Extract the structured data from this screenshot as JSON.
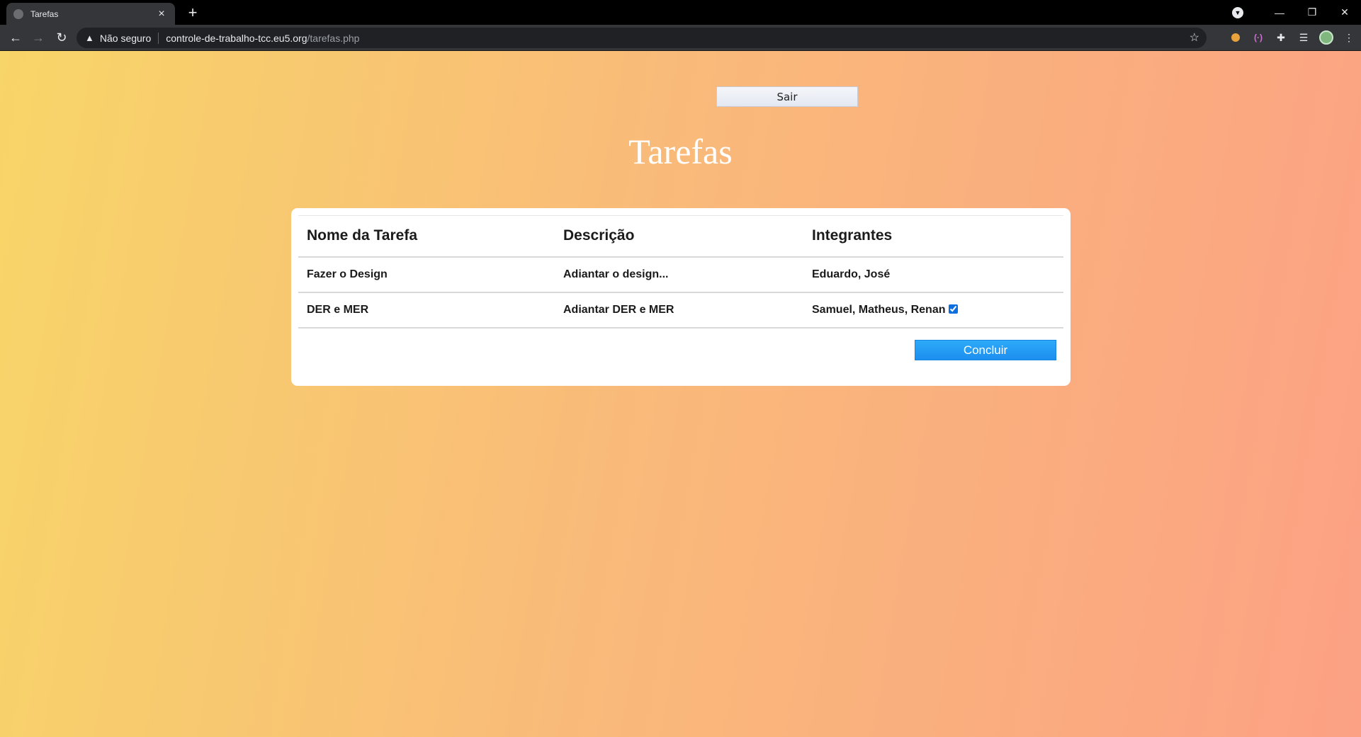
{
  "browser": {
    "tab_title": "Tarefas",
    "security_label": "Não seguro",
    "url_host": "controle-de-trabalho-tcc.eu5.org",
    "url_path": "/tarefas.php"
  },
  "page": {
    "logout_label": "Sair",
    "title": "Tarefas",
    "table": {
      "headers": [
        "Nome da Tarefa",
        "Descrição",
        "Integrantes"
      ],
      "rows": [
        {
          "name": "Fazer o Design",
          "description": "Adiantar o design...",
          "members": "Eduardo, José",
          "checkbox": false
        },
        {
          "name": "DER e MER",
          "description": "Adiantar DER e MER",
          "members": "Samuel, Matheus, Renan",
          "checkbox": true,
          "checked": true
        }
      ]
    },
    "complete_label": "Concluir"
  },
  "colors": {
    "gradient_start": "#f8d568",
    "gradient_mid": "#f9bb79",
    "gradient_end": "#fca184",
    "primary_button": "#1b8ff0"
  }
}
